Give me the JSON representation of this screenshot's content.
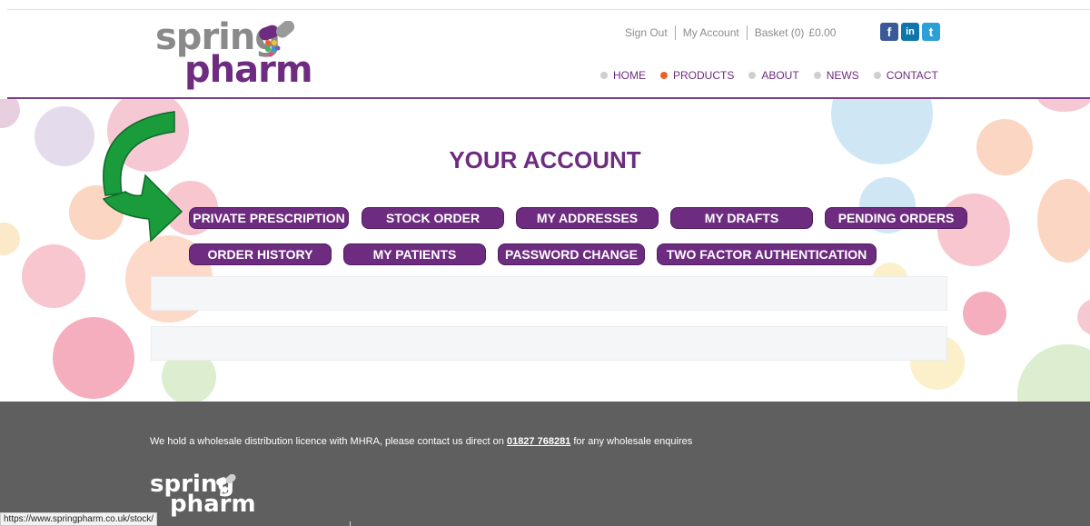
{
  "logo": {
    "word1": "spring",
    "word2": "pharm"
  },
  "header": {
    "sign_out": "Sign Out",
    "my_account": "My Account",
    "basket": "Basket (0)",
    "basket_total": "£0.00",
    "social": {
      "facebook": "f",
      "linkedin": "in",
      "twitter": "t"
    }
  },
  "nav": [
    {
      "label": "HOME",
      "active": false
    },
    {
      "label": "PRODUCTS",
      "active": true
    },
    {
      "label": "ABOUT",
      "active": false
    },
    {
      "label": "NEWS",
      "active": false
    },
    {
      "label": "CONTACT",
      "active": false
    }
  ],
  "page": {
    "title": "YOUR ACCOUNT",
    "buttons": {
      "private_prescription": "PRIVATE PRESCRIPTION",
      "stock_order": "STOCK ORDER",
      "my_addresses": "MY ADDRESSES",
      "my_drafts": "MY DRAFTS",
      "pending_orders": "PENDING ORDERS",
      "order_history": "ORDER HISTORY",
      "my_patients": "MY PATIENTS",
      "password_change": "PASSWORD CHANGE",
      "two_factor": "TWO FACTOR AUTHENTICATION"
    }
  },
  "footer": {
    "text_before": "We hold a wholesale distribution licence with MHRA, please contact us direct on ",
    "phone": "01827 768281",
    "text_after": " for any wholesale enquires",
    "logo_word1": "spring",
    "logo_word2": "pharm"
  },
  "status_url": "https://www.springpharm.co.uk/stock/",
  "colors": {
    "brand_purple": "#6d2c7f",
    "active_orange": "#e8632a",
    "arrow_green": "#1a9b3c",
    "footer_grey": "#5f5f5f"
  }
}
